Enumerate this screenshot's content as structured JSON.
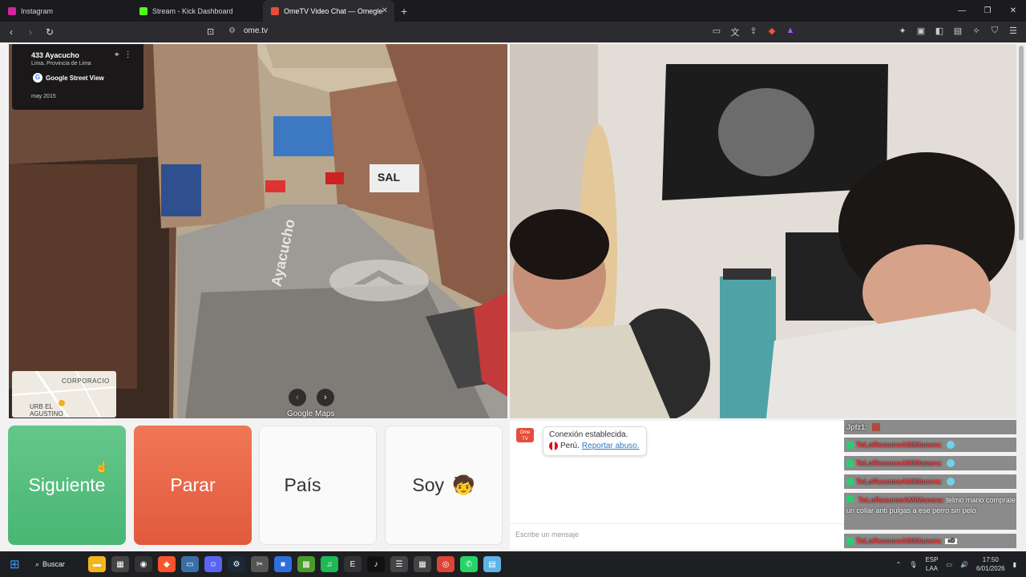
{
  "browser": {
    "tabs": [
      {
        "label": "Instagram",
        "color": "#d6249f"
      },
      {
        "label": "Stream - Kick Dashboard",
        "color": "#53fc18"
      },
      {
        "label": "OmeTV Video Chat — Omegle",
        "color": "#e74c3c",
        "active": true
      }
    ],
    "url": "ome.tv"
  },
  "streetview": {
    "address": "433 Ayacucho",
    "region": "Lima, Provincia de Lima",
    "brand": "Google Street View",
    "date": "may 2015",
    "minimap_label_top": "CORPORACIO",
    "minimap_label_bottom": "URB EL\nAGUSTINO",
    "attribution": "Google Maps",
    "street_name": "Ayacucho",
    "sign_text": "SAL"
  },
  "controls": {
    "next": "Siguiente",
    "stop": "Parar",
    "country": "País",
    "gender": "Soy",
    "gender_icon": "🧒"
  },
  "chat": {
    "logo": "Ome TV",
    "connected": "Conexión establecida.",
    "country": "Perú.",
    "report": "Reportar abuso.",
    "placeholder": "Escribe un mensaje"
  },
  "overlay": {
    "items": [
      {
        "user": "Jpfz1:",
        "text": ""
      },
      {
        "user": "TeLoResumoAMiManera:",
        "text": ""
      },
      {
        "user": "TeLoResumoAMiManera:",
        "text": ""
      },
      {
        "user": "TeLoResumoAMiManera:",
        "text": ""
      },
      {
        "user": "TeLoResumoAMiManera:",
        "text": "telmo mano comprale un collar anti pulgas a ese perro sin pelo"
      },
      {
        "user": "TeLoResumoAMiManera:",
        "text": "xD"
      }
    ]
  },
  "taskbar": {
    "search": "Buscar",
    "lang_top": "ESP",
    "lang_bottom": "LAA",
    "time": "17:50",
    "date": "6/01/2026"
  }
}
